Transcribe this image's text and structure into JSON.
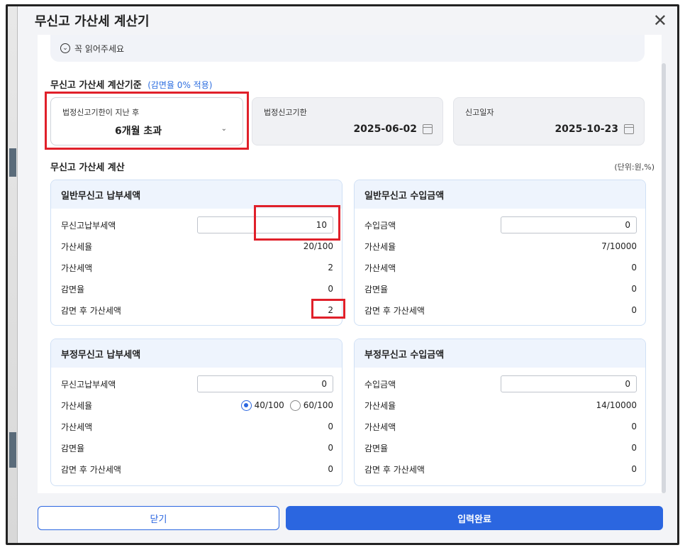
{
  "dialog": {
    "title": "무신고 가산세 계산기",
    "close_icon": "close-icon"
  },
  "notice": {
    "icon": "chevron-down-circle-icon",
    "text": "꼭 읽어주세요"
  },
  "criteria": {
    "title": "무신고 가산세 계산기준",
    "note": "(감면율 0% 적용)",
    "period_label": "법정신고기한이 지난 후",
    "period_value": "6개월 초과",
    "deadline_label": "법정신고기한",
    "deadline_value": "2025-06-02",
    "report_label": "신고일자",
    "report_value": "2025-10-23"
  },
  "calc": {
    "title": "무신고 가산세 계산",
    "unit": "(단위:원,%)"
  },
  "general_tax": {
    "title": "일반무신고 납부세액",
    "rows": [
      {
        "label": "무신고납부세액",
        "value": "10"
      },
      {
        "label": "가산세율",
        "value": "20/100"
      },
      {
        "label": "가산세액",
        "value": "2"
      },
      {
        "label": "감면율",
        "value": "0"
      },
      {
        "label": "감면 후 가산세액",
        "value": "2"
      }
    ]
  },
  "general_income": {
    "title": "일반무신고 수입금액",
    "rows": [
      {
        "label": "수입금액",
        "value": "0"
      },
      {
        "label": "가산세율",
        "value": "7/10000"
      },
      {
        "label": "가산세액",
        "value": "0"
      },
      {
        "label": "감면율",
        "value": "0"
      },
      {
        "label": "감면 후 가산세액",
        "value": "0"
      }
    ]
  },
  "fraud_tax": {
    "title": "부정무신고 납부세액",
    "rows": [
      {
        "label": "무신고납부세액",
        "value": "0"
      },
      {
        "label": "가산세율",
        "value": ""
      },
      {
        "label": "가산세액",
        "value": "0"
      },
      {
        "label": "감면율",
        "value": "0"
      },
      {
        "label": "감면 후 가산세액",
        "value": "0"
      }
    ],
    "rate_option_1": "40/100",
    "rate_option_2": "60/100",
    "selected_rate": "40/100"
  },
  "fraud_income": {
    "title": "부정무신고 수입금액",
    "rows": [
      {
        "label": "수입금액",
        "value": "0"
      },
      {
        "label": "가산세율",
        "value": "14/10000"
      },
      {
        "label": "가산세액",
        "value": "0"
      },
      {
        "label": "감면율",
        "value": "0"
      },
      {
        "label": "감면 후 가산세액",
        "value": "0"
      }
    ]
  },
  "buttons": {
    "close": "닫기",
    "submit": "입력완료"
  },
  "colors": {
    "accent": "#2b66e0",
    "highlight": "#e0202a"
  }
}
